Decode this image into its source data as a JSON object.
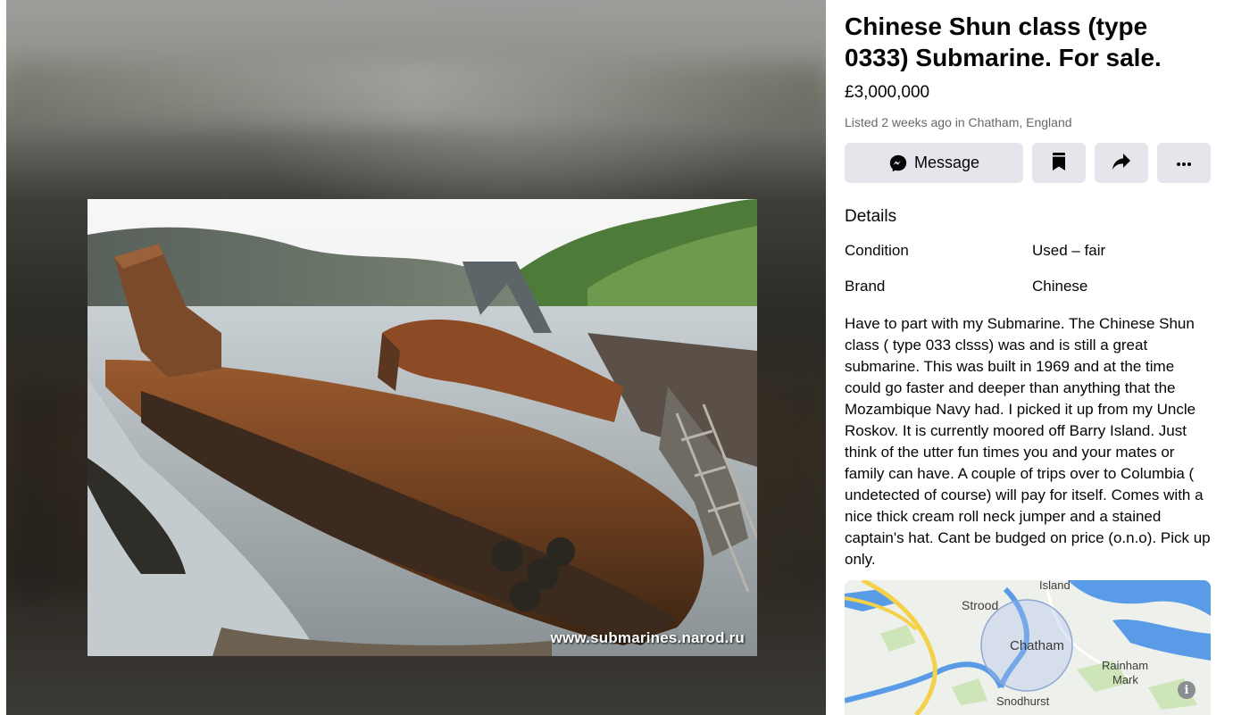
{
  "listing": {
    "title": "Chinese Shun class (type 0333) Submarine. For sale.",
    "price": "£3,000,000",
    "listed_prefix": "Listed",
    "listed_time": "2 weeks ago",
    "listed_mid": "in",
    "location": "Chatham, England"
  },
  "actions": {
    "message_label": "Message",
    "message_icon": "messenger-icon",
    "save_icon": "bookmark-icon",
    "share_icon": "share-arrow-icon",
    "more_icon": "more-dots-icon"
  },
  "details": {
    "heading": "Details",
    "rows": [
      {
        "key": "Condition",
        "value": "Used – fair"
      },
      {
        "key": "Brand",
        "value": "Chinese"
      }
    ]
  },
  "description": "Have to part with my Submarine. The Chinese Shun class ( type 033 clsss) was and is still a great submarine. This was built in 1969 and at the time could go faster and deeper than anything that the Mozambique  Navy had. I picked it up from my Uncle Roskov. It is currently moored off Barry Island. Just think of the utter fun times you and your mates or family can have. A couple of trips over to Columbia ( undetected of course) will pay for itself. Comes with a nice thick cream roll neck jumper and a stained captain's hat. Cant be budged on price (o.n.o). Pick up only.",
  "photo": {
    "watermark": "www.submarines.narod.ru"
  },
  "map": {
    "labels": {
      "island": "Island",
      "strood": "Strood",
      "chatham": "Chatham",
      "rainham": "Rainham",
      "mark": "Mark",
      "snodhurst": "Snodhurst"
    },
    "info_glyph": "i"
  },
  "colors": {
    "button_bg": "#e4e6eb",
    "muted_text": "#65676b",
    "water": "#5a9be8",
    "road": "#f3d24a",
    "park": "#cde5b8"
  }
}
